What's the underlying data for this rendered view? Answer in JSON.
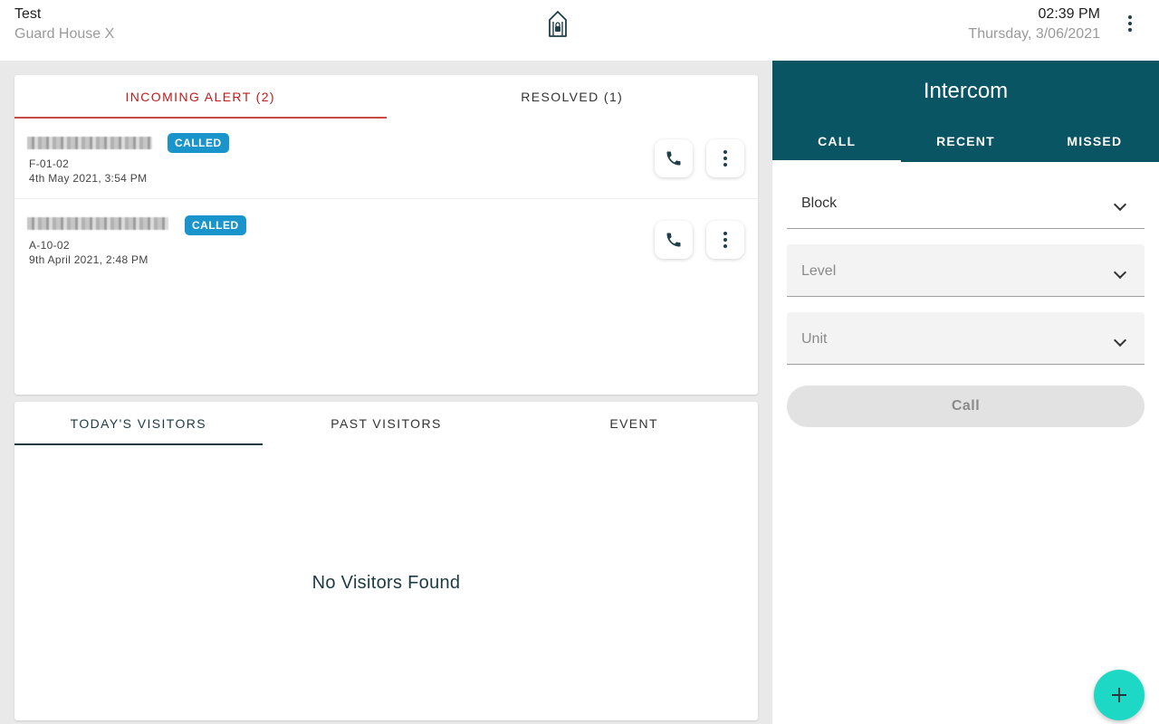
{
  "header": {
    "title": "Test",
    "subtitle": "Guard House X",
    "time": "02:39 PM",
    "date": "Thursday, 3/06/2021",
    "logo_icon": "lock-house-icon",
    "menu_icon": "more-vert-icon"
  },
  "alerts": {
    "tabs": [
      {
        "label": "INCOMING ALERT (2)",
        "active": true
      },
      {
        "label": "RESOLVED (1)",
        "active": false
      }
    ],
    "items": [
      {
        "badge": "CALLED",
        "unit": "F-01-02",
        "datetime": "4th May 2021, 3:54 PM"
      },
      {
        "badge": "CALLED",
        "unit": "A-10-02",
        "datetime": "9th April 2021, 2:48 PM"
      }
    ],
    "active_color": "#c21a1a",
    "badge_color": "#1a95cc"
  },
  "visitors": {
    "tabs": [
      {
        "label": "TODAY'S VISITORS",
        "active": true
      },
      {
        "label": "PAST VISITORS",
        "active": false
      },
      {
        "label": "EVENT",
        "active": false
      }
    ],
    "empty_message": "No Visitors Found"
  },
  "intercom": {
    "title": "Intercom",
    "tabs": [
      {
        "label": "CALL",
        "active": true
      },
      {
        "label": "RECENT",
        "active": false
      },
      {
        "label": "MISSED",
        "active": false
      }
    ],
    "fields": {
      "block": "Block",
      "level": "Level",
      "unit": "Unit"
    },
    "call_button": "Call",
    "header_color": "#0a5563"
  },
  "fab": {
    "icon": "plus-icon",
    "color": "#1dd8c4"
  }
}
